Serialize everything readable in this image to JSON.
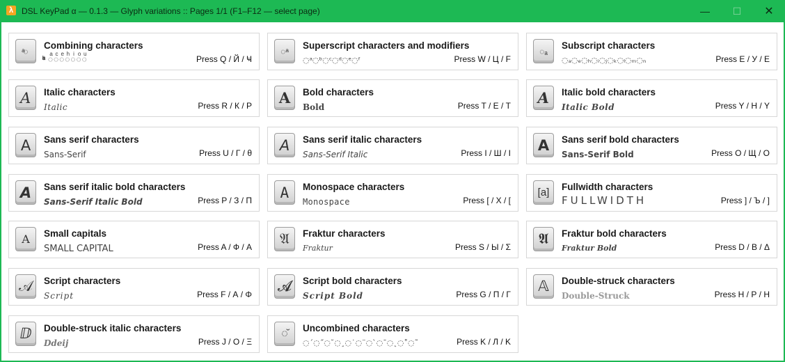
{
  "window": {
    "title": "DSL KeyPad α — 0.1.3 — Glyph variations   ::   Pages 1/1 (F1–F12 — select page)",
    "icon_glyph": "λ",
    "min_glyph": "—",
    "max_glyph": "☐",
    "close_glyph": "✕"
  },
  "cards": [
    {
      "title": "Combining characters",
      "sample": "ͣͨͤͪͥͦͧ ◌ͣ◌ͨ◌ͤ◌ͪ◌ͥ◌ͦ◌ͧ",
      "press": "Press Q / Й / Ҹ",
      "key": "ͣ◌"
    },
    {
      "title": "Superscript characters and modifiers",
      "sample": "◌ᵃ◌ᵇ◌ᶜ◌ᵈ◌ᵉ◌ᶠ",
      "press": "Press W / Ц / F",
      "key": "◌ᵃ"
    },
    {
      "title": "Subscript characters",
      "sample": "◌ₐ◌ₑ◌ₕ◌ᵢ◌ⱼ◌ₖ◌ₗ◌ₘ◌ₙ",
      "press": "Press E / У / E",
      "key": "◌ₐ"
    },
    {
      "title": "Italic characters",
      "sample": "Italic",
      "press": "Press R / К / P",
      "key": "A"
    },
    {
      "title": "Bold characters",
      "sample": "Bold",
      "press": "Press T / Е / T",
      "key": "A"
    },
    {
      "title": "Italic bold characters",
      "sample": "Italic Bold",
      "press": "Press Y / Н / Y",
      "key": "A"
    },
    {
      "title": "Sans serif characters",
      "sample": "Sans-Serif",
      "press": "Press U / Г / θ",
      "key": "A"
    },
    {
      "title": "Sans serif italic characters",
      "sample": "Sans-Serif Italic",
      "press": "Press I / Ш / I",
      "key": "A"
    },
    {
      "title": "Sans serif bold characters",
      "sample": "Sans-Serif Bold",
      "press": "Press O / Щ / O",
      "key": "A"
    },
    {
      "title": "Sans serif italic bold characters",
      "sample": "Sans-Serif Italic Bold",
      "press": "Press P / З / Π",
      "key": "A"
    },
    {
      "title": "Monospace characters",
      "sample": "Monospace",
      "press": "Press [ / Х / [",
      "key": "A"
    },
    {
      "title": "Fullwidth characters",
      "sample": "FULLWIDTH",
      "press": "Press ] / Ъ / ]",
      "key": "[a]"
    },
    {
      "title": "Small capitals",
      "sample": "SMALL CAPITAL",
      "press": "Press A / Ф / A",
      "key": "A"
    },
    {
      "title": "Fraktur characters",
      "sample": "Fraktur",
      "press": "Press S / Ы / Σ",
      "key": "𝔄"
    },
    {
      "title": "Fraktur bold characters",
      "sample": "Fraktur Bold",
      "press": "Press D / В / Δ",
      "key": "𝕬"
    },
    {
      "title": "Script characters",
      "sample": "Script",
      "press": "Press F / А / Φ",
      "key": "𝒜"
    },
    {
      "title": "Script bold characters",
      "sample": "Script Bold",
      "press": "Press G / П / Γ",
      "key": "𝓐"
    },
    {
      "title": "Double-struck characters",
      "sample": "Double-Struck",
      "press": "Press H / Р / H",
      "key": "𝔸"
    },
    {
      "title": "Double-struck italic characters",
      "sample": "Ddeij",
      "press": "Press J / О / Ξ",
      "key": "ⅅ"
    },
    {
      "title": "Uncombined characters",
      "sample": "◌´◌˝◌˘◌¸◌˙◌¨◌`◌ˉ◌˛◌˚◌˜",
      "press": "Press K / Л / K",
      "key": "◌̆"
    }
  ]
}
